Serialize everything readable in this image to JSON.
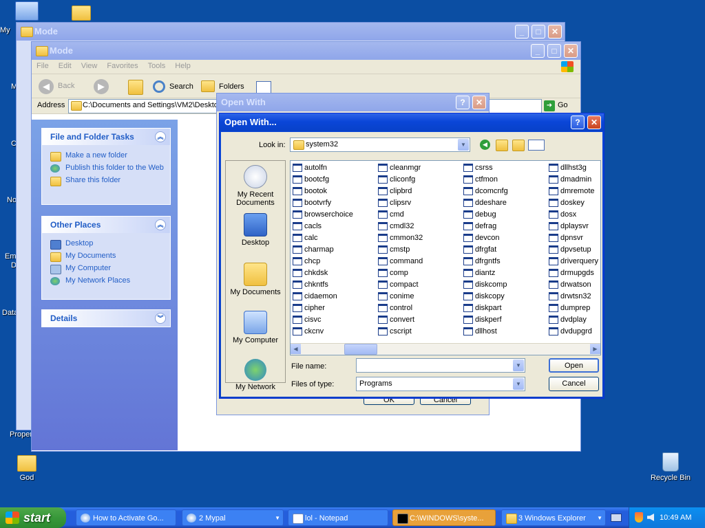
{
  "desktop": {
    "icons": [
      {
        "label": "God"
      },
      {
        "label": "Recycle Bin"
      }
    ],
    "edge_labels": [
      "My",
      "M",
      "C",
      "No",
      "Em",
      "D",
      "Data",
      "Proper"
    ]
  },
  "explorer_back": {
    "title": "Mode"
  },
  "explorer_front": {
    "title": "Mode",
    "menu": [
      "File",
      "Edit",
      "View",
      "Favorites",
      "Tools",
      "Help"
    ],
    "toolbar": {
      "back": "Back",
      "search": "Search",
      "folders": "Folders"
    },
    "address_label": "Address",
    "address_value": "C:\\Documents and Settings\\VM2\\Desktop",
    "go_label": "Go",
    "file_folder_tasks": {
      "title": "File and Folder Tasks",
      "items": [
        "Make a new folder",
        "Publish this folder to the Web",
        "Share this folder"
      ]
    },
    "other_places": {
      "title": "Other Places",
      "items": [
        "Desktop",
        "My Documents",
        "My Computer",
        "My Network Places"
      ]
    },
    "details": {
      "title": "Details"
    }
  },
  "openwith_back": {
    "title": "Open With",
    "ok": "OK",
    "cancel": "Cancel"
  },
  "openwith_dialog": {
    "title": "Open With...",
    "look_in_label": "Look in:",
    "look_in_value": "system32",
    "places": [
      "My Recent Documents",
      "Desktop",
      "My Documents",
      "My Computer",
      "My Network"
    ],
    "files": [
      [
        "autolfn",
        "bootcfg",
        "bootok",
        "bootvrfy",
        "browserchoice",
        "cacls",
        "calc",
        "charmap",
        "chcp",
        "chkdsk",
        "chkntfs",
        "cidaemon",
        "cipher",
        "cisvc",
        "ckcnv"
      ],
      [
        "cleanmgr",
        "cliconfg",
        "clipbrd",
        "clipsrv",
        "cmd",
        "cmdl32",
        "cmmon32",
        "cmstp",
        "command",
        "comp",
        "compact",
        "conime",
        "control",
        "convert",
        "cscript"
      ],
      [
        "csrss",
        "ctfmon",
        "dcomcnfg",
        "ddeshare",
        "debug",
        "defrag",
        "devcon",
        "dfrgfat",
        "dfrgntfs",
        "diantz",
        "diskcomp",
        "diskcopy",
        "diskpart",
        "diskperf",
        "dllhost"
      ],
      [
        "dllhst3g",
        "dmadmin",
        "dmremote",
        "doskey",
        "dosx",
        "dplaysvr",
        "dpnsvr",
        "dpvsetup",
        "driverquery",
        "drmupgds",
        "drwatson",
        "drwtsn32",
        "dumprep",
        "dvdplay",
        "dvdupgrd"
      ]
    ],
    "file_name_label": "File name:",
    "file_name_value": "",
    "file_type_label": "Files of type:",
    "file_type_value": "Programs",
    "open_label": "Open",
    "cancel_label": "Cancel"
  },
  "taskbar": {
    "start_label": "start",
    "tasks": [
      "How to Activate Go...",
      "2 Mypal",
      "lol - Notepad",
      "C:\\WINDOWS\\syste...",
      "3 Windows Explorer"
    ],
    "clock": "10:49 AM"
  }
}
